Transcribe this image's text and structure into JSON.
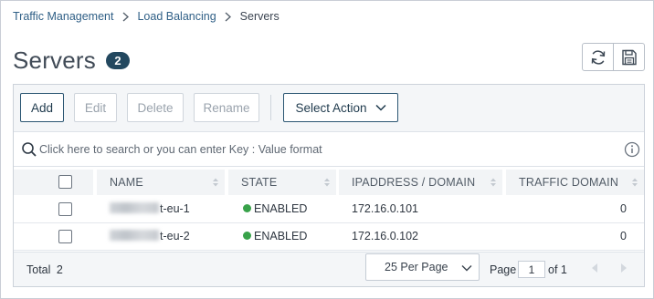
{
  "breadcrumb": {
    "items": [
      "Traffic Management",
      "Load Balancing"
    ],
    "current": "Servers"
  },
  "page": {
    "title": "Servers",
    "count_badge": "2"
  },
  "toolbar": {
    "add_label": "Add",
    "edit_label": "Edit",
    "delete_label": "Delete",
    "rename_label": "Rename",
    "select_action_label": "Select Action"
  },
  "search": {
    "placeholder": "Click here to search or you can enter Key : Value format"
  },
  "table": {
    "columns": [
      "NAME",
      "STATE",
      "IPADDRESS / DOMAIN",
      "TRAFFIC DOMAIN"
    ],
    "rows": [
      {
        "name_suffix": "t-eu-1",
        "state": "ENABLED",
        "ip": "172.16.0.101",
        "traffic_domain": "0"
      },
      {
        "name_suffix": "t-eu-2",
        "state": "ENABLED",
        "ip": "172.16.0.102",
        "traffic_domain": "0"
      }
    ]
  },
  "footer": {
    "total_label": "Total",
    "total_value": "2",
    "per_page_label": "25 Per Page",
    "page_label": "Page",
    "page_value": "1",
    "page_of_label": "of 1"
  },
  "colors": {
    "badge": "#23485f",
    "enabled_dot": "#38a24a",
    "link": "#2f5f86"
  }
}
